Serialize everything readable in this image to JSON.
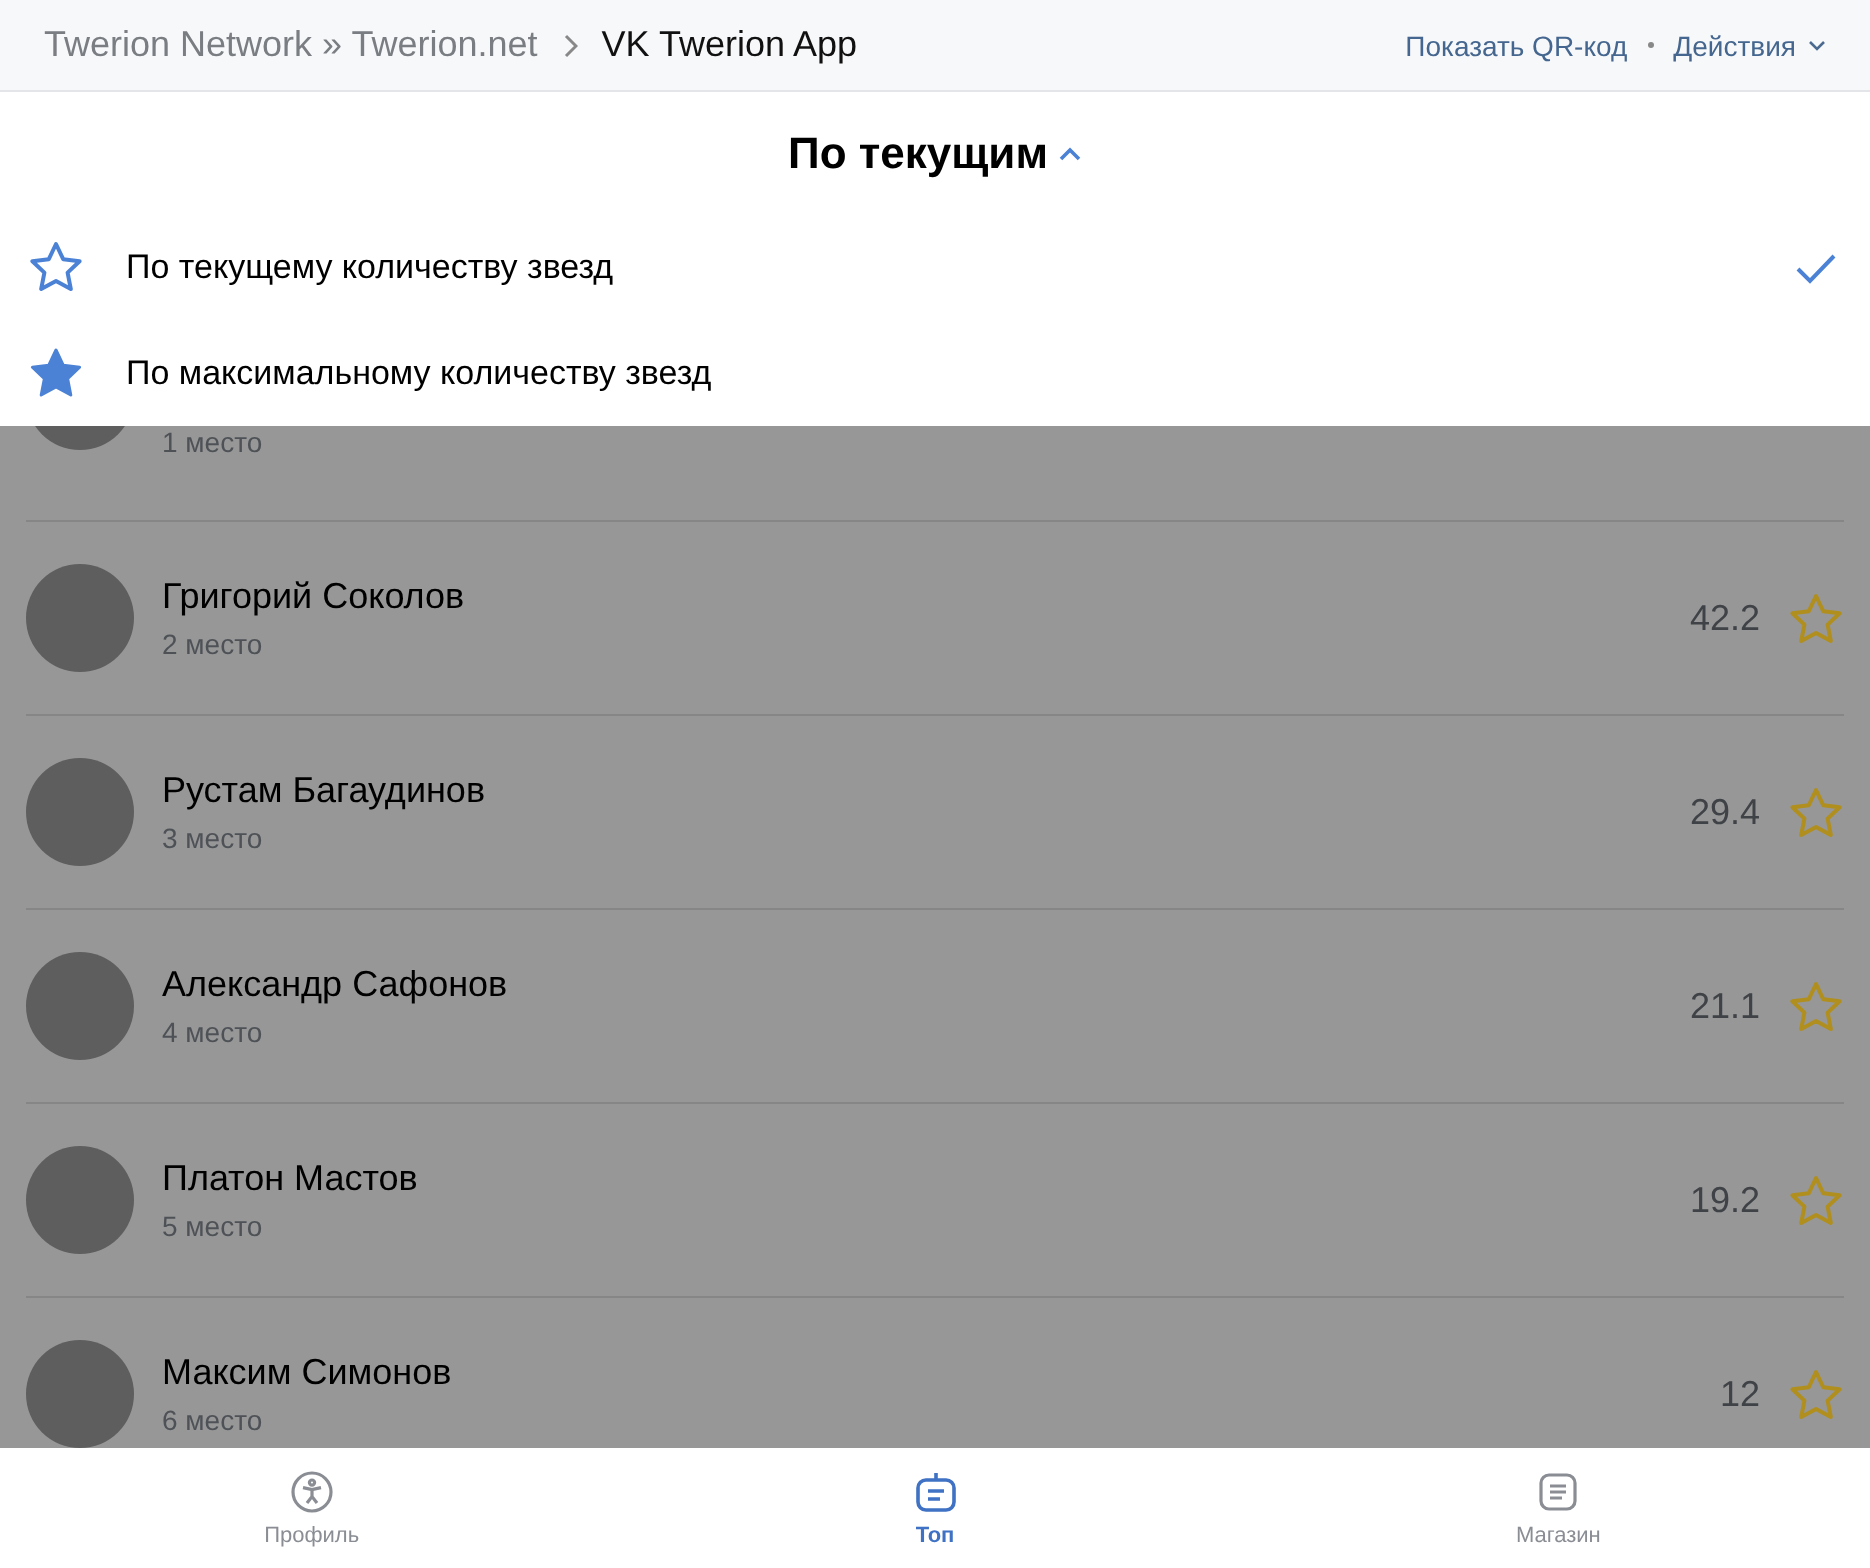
{
  "header": {
    "breadcrumbs": [
      "Twerion Network » Twerion.net",
      "VK Twerion App"
    ],
    "actions": [
      "Показать QR-код",
      "Действия"
    ]
  },
  "sort_menu": {
    "title": "По текущим",
    "options": [
      {
        "label": "По текущему количеству звезд",
        "kind": "outline",
        "selected": true
      },
      {
        "label": "По максимальному количеству звезд",
        "kind": "filled",
        "selected": false
      }
    ]
  },
  "leaderboard": [
    {
      "place": "1 место"
    },
    {
      "name": "Григорий Соколов",
      "place": "2 место",
      "score": "42.2"
    },
    {
      "name": "Рустам Багаудинов",
      "place": "3 место",
      "score": "29.4"
    },
    {
      "name": "Александр Сафонов",
      "place": "4 место",
      "score": "21.1"
    },
    {
      "name": "Платон Мастов",
      "place": "5 место",
      "score": "19.2"
    },
    {
      "name": "Максим Симонов",
      "place": "6 место",
      "score": "12"
    }
  ],
  "tab_bar": [
    {
      "label": "Профиль",
      "kind": "profile",
      "selected": false
    },
    {
      "label": "Топ",
      "kind": "top",
      "selected": true
    },
    {
      "label": "Магазин",
      "kind": "shop",
      "selected": false
    }
  ]
}
